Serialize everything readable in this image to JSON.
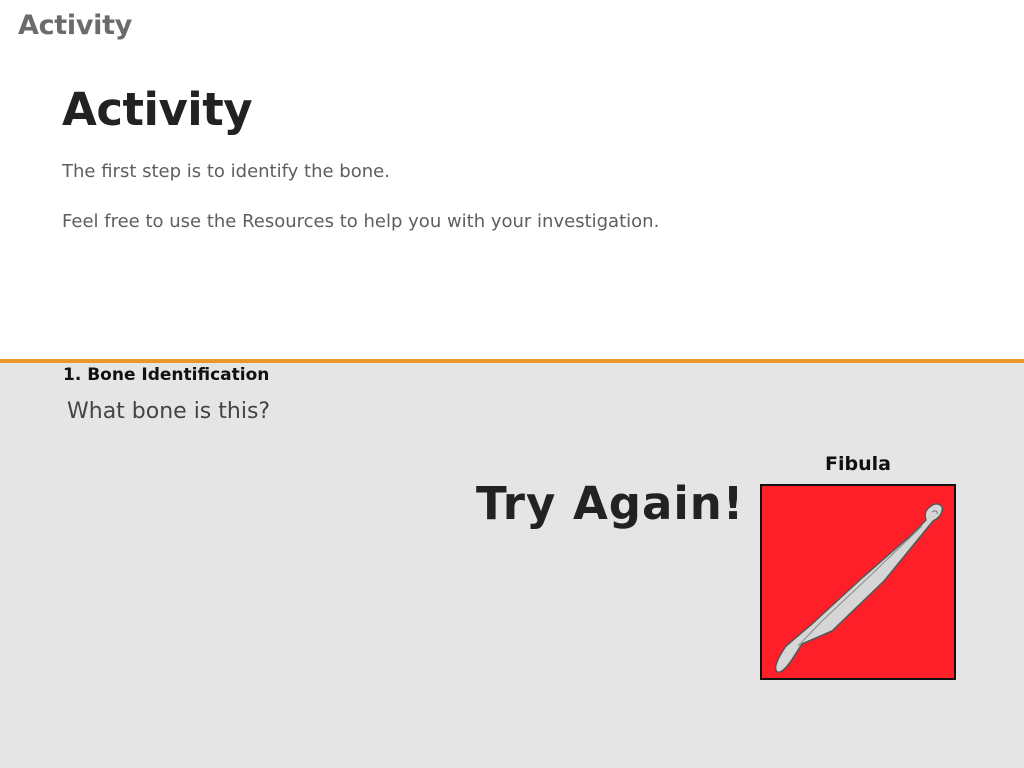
{
  "header": {
    "label": "Activity"
  },
  "intro": {
    "title": "Activity",
    "paragraphs": [
      "The first step is to identify the bone.",
      "Feel free to use the Resources to help you with your investigation."
    ]
  },
  "activity": {
    "section_title": "1. Bone Identification",
    "question": "What bone is this?",
    "feedback": "Try Again!",
    "answer": {
      "label": "Fibula",
      "icon": "fibula-bone-icon"
    }
  },
  "colors": {
    "accent": "#e9962a",
    "card_background": "#ff1f28",
    "section_background": "#e5e5e5",
    "bone_fill": "#d6d6d6"
  }
}
